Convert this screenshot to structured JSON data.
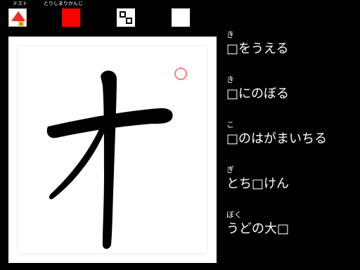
{
  "toolbar": {
    "test_label": "テスト",
    "kanji_label": "とりしまりかんじ",
    "home_icon": "house-flag-icon",
    "color_swatch": "#ff0000",
    "pattern_icon": "grid-pattern-icon"
  },
  "kanji": {
    "character": "オ",
    "circle_color": "#f08080"
  },
  "words": [
    {
      "reading": "き",
      "word": "□をうえる"
    },
    {
      "reading": "き",
      "word": "□にのぼる"
    },
    {
      "reading": "こ",
      "word": "□のはがまいちる"
    },
    {
      "reading": "ぎ",
      "word": "とち□けん"
    },
    {
      "reading": "ぼく",
      "word": "うどの大□"
    }
  ]
}
